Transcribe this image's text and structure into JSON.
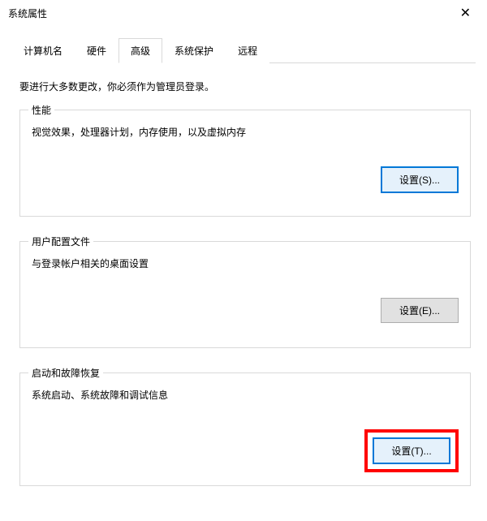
{
  "window": {
    "title": "系统属性",
    "close": "✕"
  },
  "tabs": {
    "items": [
      {
        "label": "计算机名"
      },
      {
        "label": "硬件"
      },
      {
        "label": "高级"
      },
      {
        "label": "系统保护"
      },
      {
        "label": "远程"
      }
    ],
    "active_index": 2
  },
  "intro_text": "要进行大多数更改，你必须作为管理员登录。",
  "groups": {
    "performance": {
      "title": "性能",
      "desc": "视觉效果，处理器计划，内存使用，以及虚拟内存",
      "button_label": "设置(S)..."
    },
    "user_profiles": {
      "title": "用户配置文件",
      "desc": "与登录帐户相关的桌面设置",
      "button_label": "设置(E)..."
    },
    "startup_recovery": {
      "title": "启动和故障恢复",
      "desc": "系统启动、系统故障和调试信息",
      "button_label": "设置(T)..."
    }
  }
}
